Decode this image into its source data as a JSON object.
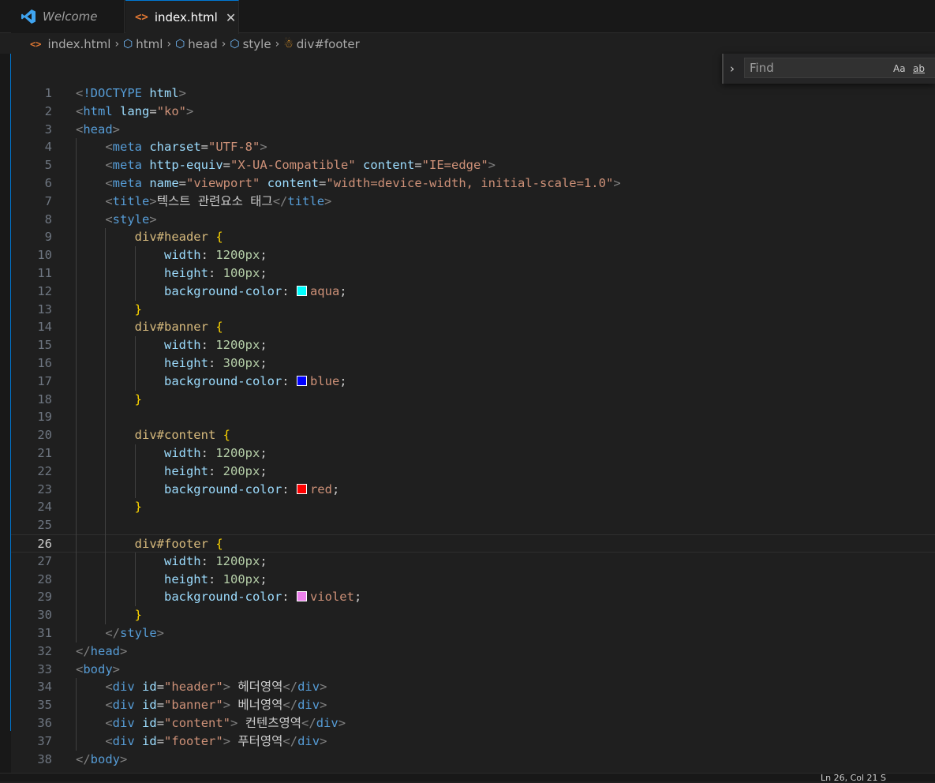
{
  "tabs": [
    {
      "label": "Welcome",
      "icon": "vscode-icon",
      "active": false
    },
    {
      "label": "index.html",
      "icon": "html-file-icon",
      "active": true,
      "close": "✕"
    }
  ],
  "breadcrumb": [
    "index.html",
    "html",
    "head",
    "style",
    "div#footer"
  ],
  "find": {
    "placeholder": "Find",
    "match_case": "Aa",
    "whole_word": "ab"
  },
  "status": {
    "text": "Ln 26, Col 21   S"
  },
  "active_line": 26,
  "lines": [
    [
      [
        "t-punc",
        "<"
      ],
      [
        "t-tag",
        "!DOCTYPE"
      ],
      [
        "t-plain",
        " "
      ],
      [
        "t-attr",
        "html"
      ],
      [
        "t-punc",
        ">"
      ]
    ],
    [
      [
        "t-punc",
        "<"
      ],
      [
        "t-tag",
        "html"
      ],
      [
        "t-plain",
        " "
      ],
      [
        "t-attr",
        "lang"
      ],
      [
        "t-plain",
        "="
      ],
      [
        "t-str",
        "\"ko\""
      ],
      [
        "t-punc",
        ">"
      ]
    ],
    [
      [
        "t-punc",
        "<"
      ],
      [
        "t-tag",
        "head"
      ],
      [
        "t-punc",
        ">"
      ]
    ],
    [
      [
        "t-plain",
        "    "
      ],
      [
        "t-punc",
        "<"
      ],
      [
        "t-tag",
        "meta"
      ],
      [
        "t-plain",
        " "
      ],
      [
        "t-attr",
        "charset"
      ],
      [
        "t-plain",
        "="
      ],
      [
        "t-str",
        "\"UTF-8\""
      ],
      [
        "t-punc",
        ">"
      ]
    ],
    [
      [
        "t-plain",
        "    "
      ],
      [
        "t-punc",
        "<"
      ],
      [
        "t-tag",
        "meta"
      ],
      [
        "t-plain",
        " "
      ],
      [
        "t-attr",
        "http-equiv"
      ],
      [
        "t-plain",
        "="
      ],
      [
        "t-str",
        "\"X-UA-Compatible\""
      ],
      [
        "t-plain",
        " "
      ],
      [
        "t-attr",
        "content"
      ],
      [
        "t-plain",
        "="
      ],
      [
        "t-str",
        "\"IE=edge\""
      ],
      [
        "t-punc",
        ">"
      ]
    ],
    [
      [
        "t-plain",
        "    "
      ],
      [
        "t-punc",
        "<"
      ],
      [
        "t-tag",
        "meta"
      ],
      [
        "t-plain",
        " "
      ],
      [
        "t-attr",
        "name"
      ],
      [
        "t-plain",
        "="
      ],
      [
        "t-str",
        "\"viewport\""
      ],
      [
        "t-plain",
        " "
      ],
      [
        "t-attr",
        "content"
      ],
      [
        "t-plain",
        "="
      ],
      [
        "t-str",
        "\"width=device-width, initial-scale=1.0\""
      ],
      [
        "t-punc",
        ">"
      ]
    ],
    [
      [
        "t-plain",
        "    "
      ],
      [
        "t-punc",
        "<"
      ],
      [
        "t-tag",
        "title"
      ],
      [
        "t-punc",
        ">"
      ],
      [
        "t-text",
        "텍스트 관련요소 태그"
      ],
      [
        "t-punc",
        "</"
      ],
      [
        "t-tag",
        "title"
      ],
      [
        "t-punc",
        ">"
      ]
    ],
    [
      [
        "t-plain",
        "    "
      ],
      [
        "t-punc",
        "<"
      ],
      [
        "t-tag",
        "style"
      ],
      [
        "t-punc",
        ">"
      ]
    ],
    [
      [
        "t-plain",
        "        "
      ],
      [
        "t-sel",
        "div#header"
      ],
      [
        "t-plain",
        " "
      ],
      [
        "t-brace",
        "{"
      ]
    ],
    [
      [
        "t-plain",
        "            "
      ],
      [
        "t-prop",
        "width"
      ],
      [
        "t-plain",
        ": "
      ],
      [
        "t-num",
        "1200px"
      ],
      [
        "t-plain",
        ";"
      ]
    ],
    [
      [
        "t-plain",
        "            "
      ],
      [
        "t-prop",
        "height"
      ],
      [
        "t-plain",
        ": "
      ],
      [
        "t-num",
        "100px"
      ],
      [
        "t-plain",
        ";"
      ]
    ],
    [
      [
        "t-plain",
        "            "
      ],
      [
        "t-prop",
        "background-color"
      ],
      [
        "t-plain",
        ": "
      ],
      [
        "swatch",
        "#00ffff"
      ],
      [
        "t-val",
        "aqua"
      ],
      [
        "t-plain",
        ";"
      ]
    ],
    [
      [
        "t-plain",
        "        "
      ],
      [
        "t-brace",
        "}"
      ]
    ],
    [
      [
        "t-plain",
        "        "
      ],
      [
        "t-sel",
        "div#banner"
      ],
      [
        "t-plain",
        " "
      ],
      [
        "t-brace",
        "{"
      ]
    ],
    [
      [
        "t-plain",
        "            "
      ],
      [
        "t-prop",
        "width"
      ],
      [
        "t-plain",
        ": "
      ],
      [
        "t-num",
        "1200px"
      ],
      [
        "t-plain",
        ";"
      ]
    ],
    [
      [
        "t-plain",
        "            "
      ],
      [
        "t-prop",
        "height"
      ],
      [
        "t-plain",
        ": "
      ],
      [
        "t-num",
        "300px"
      ],
      [
        "t-plain",
        ";"
      ]
    ],
    [
      [
        "t-plain",
        "            "
      ],
      [
        "t-prop",
        "background-color"
      ],
      [
        "t-plain",
        ": "
      ],
      [
        "swatch",
        "#0000ff"
      ],
      [
        "t-val",
        "blue"
      ],
      [
        "t-plain",
        ";"
      ]
    ],
    [
      [
        "t-plain",
        "        "
      ],
      [
        "t-brace",
        "}"
      ]
    ],
    [],
    [
      [
        "t-plain",
        "        "
      ],
      [
        "t-sel",
        "div#content"
      ],
      [
        "t-plain",
        " "
      ],
      [
        "t-brace",
        "{"
      ]
    ],
    [
      [
        "t-plain",
        "            "
      ],
      [
        "t-prop",
        "width"
      ],
      [
        "t-plain",
        ": "
      ],
      [
        "t-num",
        "1200px"
      ],
      [
        "t-plain",
        ";"
      ]
    ],
    [
      [
        "t-plain",
        "            "
      ],
      [
        "t-prop",
        "height"
      ],
      [
        "t-plain",
        ": "
      ],
      [
        "t-num",
        "200px"
      ],
      [
        "t-plain",
        ";"
      ]
    ],
    [
      [
        "t-plain",
        "            "
      ],
      [
        "t-prop",
        "background-color"
      ],
      [
        "t-plain",
        ": "
      ],
      [
        "swatch",
        "#ff0000"
      ],
      [
        "t-val",
        "red"
      ],
      [
        "t-plain",
        ";"
      ]
    ],
    [
      [
        "t-plain",
        "        "
      ],
      [
        "t-brace",
        "}"
      ]
    ],
    [],
    [
      [
        "t-plain",
        "        "
      ],
      [
        "t-sel",
        "div#footer"
      ],
      [
        "t-plain",
        " "
      ],
      [
        "t-brace",
        "{"
      ]
    ],
    [
      [
        "t-plain",
        "            "
      ],
      [
        "t-prop",
        "width"
      ],
      [
        "t-plain",
        ": "
      ],
      [
        "t-num",
        "1200px"
      ],
      [
        "t-plain",
        ";"
      ]
    ],
    [
      [
        "t-plain",
        "            "
      ],
      [
        "t-prop",
        "height"
      ],
      [
        "t-plain",
        ": "
      ],
      [
        "t-num",
        "100px"
      ],
      [
        "t-plain",
        ";"
      ]
    ],
    [
      [
        "t-plain",
        "            "
      ],
      [
        "t-prop",
        "background-color"
      ],
      [
        "t-plain",
        ": "
      ],
      [
        "swatch",
        "#ee82ee"
      ],
      [
        "t-val",
        "violet"
      ],
      [
        "t-plain",
        ";"
      ]
    ],
    [
      [
        "t-plain",
        "        "
      ],
      [
        "t-brace",
        "}"
      ]
    ],
    [
      [
        "t-plain",
        "    "
      ],
      [
        "t-punc",
        "</"
      ],
      [
        "t-tag",
        "style"
      ],
      [
        "t-punc",
        ">"
      ]
    ],
    [
      [
        "t-punc",
        "</"
      ],
      [
        "t-tag",
        "head"
      ],
      [
        "t-punc",
        ">"
      ]
    ],
    [
      [
        "t-punc",
        "<"
      ],
      [
        "t-tag",
        "body"
      ],
      [
        "t-punc",
        ">"
      ]
    ],
    [
      [
        "t-plain",
        "    "
      ],
      [
        "t-punc",
        "<"
      ],
      [
        "t-tag",
        "div"
      ],
      [
        "t-plain",
        " "
      ],
      [
        "t-attr",
        "id"
      ],
      [
        "t-plain",
        "="
      ],
      [
        "t-str",
        "\"header\""
      ],
      [
        "t-punc",
        ">"
      ],
      [
        "t-text",
        " 헤더영역"
      ],
      [
        "t-punc",
        "</"
      ],
      [
        "t-tag",
        "div"
      ],
      [
        "t-punc",
        ">"
      ]
    ],
    [
      [
        "t-plain",
        "    "
      ],
      [
        "t-punc",
        "<"
      ],
      [
        "t-tag",
        "div"
      ],
      [
        "t-plain",
        " "
      ],
      [
        "t-attr",
        "id"
      ],
      [
        "t-plain",
        "="
      ],
      [
        "t-str",
        "\"banner\""
      ],
      [
        "t-punc",
        ">"
      ],
      [
        "t-text",
        " 베너영역"
      ],
      [
        "t-punc",
        "</"
      ],
      [
        "t-tag",
        "div"
      ],
      [
        "t-punc",
        ">"
      ]
    ],
    [
      [
        "t-plain",
        "    "
      ],
      [
        "t-punc",
        "<"
      ],
      [
        "t-tag",
        "div"
      ],
      [
        "t-plain",
        " "
      ],
      [
        "t-attr",
        "id"
      ],
      [
        "t-plain",
        "="
      ],
      [
        "t-str",
        "\"content\""
      ],
      [
        "t-punc",
        ">"
      ],
      [
        "t-text",
        " 컨텐츠영역"
      ],
      [
        "t-punc",
        "</"
      ],
      [
        "t-tag",
        "div"
      ],
      [
        "t-punc",
        ">"
      ]
    ],
    [
      [
        "t-plain",
        "    "
      ],
      [
        "t-punc",
        "<"
      ],
      [
        "t-tag",
        "div"
      ],
      [
        "t-plain",
        " "
      ],
      [
        "t-attr",
        "id"
      ],
      [
        "t-plain",
        "="
      ],
      [
        "t-str",
        "\"footer\""
      ],
      [
        "t-punc",
        ">"
      ],
      [
        "t-text",
        " 푸터영역"
      ],
      [
        "t-punc",
        "</"
      ],
      [
        "t-tag",
        "div"
      ],
      [
        "t-punc",
        ">"
      ]
    ],
    [
      [
        "t-punc",
        "</"
      ],
      [
        "t-tag",
        "body"
      ],
      [
        "t-punc",
        ">"
      ]
    ]
  ]
}
